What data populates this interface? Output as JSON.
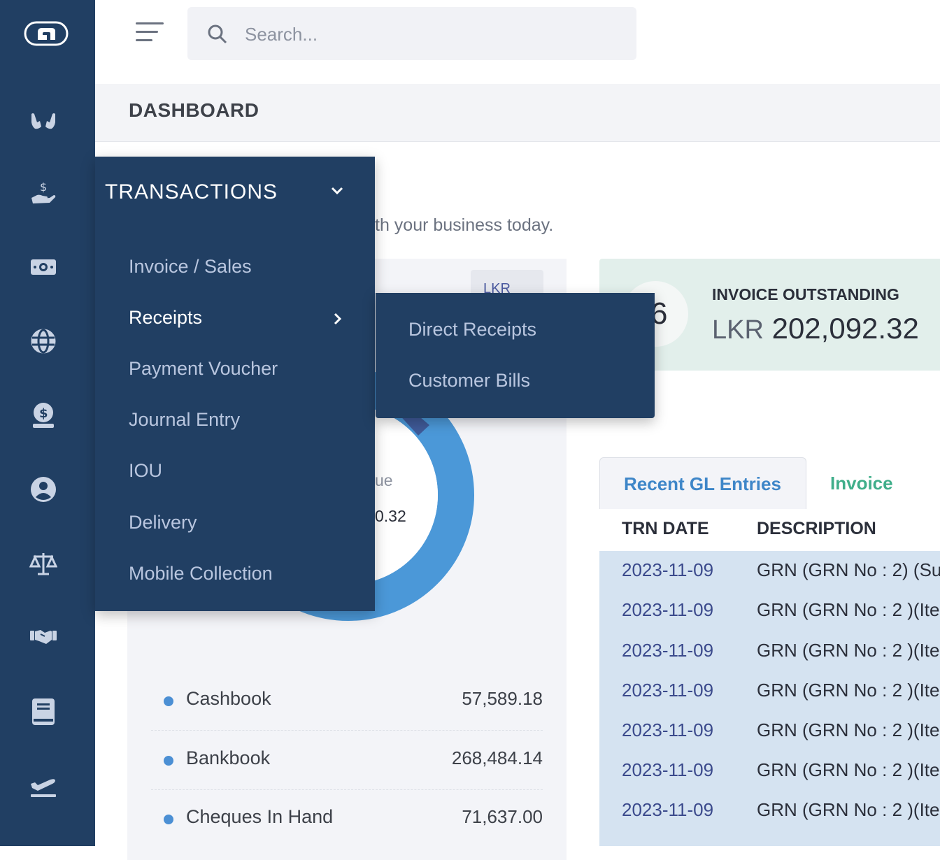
{
  "search": {
    "placeholder": "Search..."
  },
  "page": {
    "title": "DASHBOARD",
    "subtitle": "th your business today."
  },
  "currency_select": {
    "value": "LKR"
  },
  "donut": {
    "label": "ue",
    "value": "0.32",
    "colors": {
      "primary": "#4b98d8",
      "accent": "#3f5a98"
    }
  },
  "balances": [
    {
      "label": "Cashbook",
      "value": "57,589.18"
    },
    {
      "label": "Bankbook",
      "value": "268,484.14"
    },
    {
      "label": "Cheques In Hand",
      "value": "71,637.00"
    }
  ],
  "stat": {
    "count": "6",
    "title": "INVOICE OUTSTANDING",
    "currency": "LKR",
    "amount": "202,092.32"
  },
  "tabs": [
    {
      "label": "Recent GL Entries"
    },
    {
      "label": "Invoice"
    }
  ],
  "table": {
    "columns": [
      "TRN DATE",
      "DESCRIPTION"
    ],
    "rows": [
      {
        "date": "2023-11-09",
        "desc": "GRN (GRN No : 2) (Su"
      },
      {
        "date": "2023-11-09",
        "desc": "GRN (GRN No : 2 )(Ite"
      },
      {
        "date": "2023-11-09",
        "desc": "GRN (GRN No : 2 )(Ite"
      },
      {
        "date": "2023-11-09",
        "desc": "GRN (GRN No : 2 )(Ite"
      },
      {
        "date": "2023-11-09",
        "desc": "GRN (GRN No : 2 )(Ite"
      },
      {
        "date": "2023-11-09",
        "desc": "GRN (GRN No : 2 )(Ite"
      },
      {
        "date": "2023-11-09",
        "desc": "GRN (GRN No : 2 )(Ite"
      }
    ]
  },
  "menu": {
    "title": "TRANSACTIONS",
    "items": [
      {
        "label": "Invoice / Sales"
      },
      {
        "label": "Receipts"
      },
      {
        "label": "Payment Voucher"
      },
      {
        "label": "Journal Entry"
      },
      {
        "label": "IOU"
      },
      {
        "label": "Delivery"
      },
      {
        "label": "Mobile Collection"
      }
    ],
    "submenu": [
      {
        "label": "Direct Receipts"
      },
      {
        "label": "Customer Bills"
      }
    ]
  },
  "sidebar": {
    "icons": [
      "hands-icon",
      "hand-dollar-icon",
      "banknote-icon",
      "globe-icon",
      "money-bag-icon",
      "user-circle-icon",
      "scale-icon",
      "handshake-icon",
      "book-icon",
      "plane-departure-icon"
    ]
  },
  "colors": {
    "sidebar": "#213f63",
    "active_tab": "#3e86c8",
    "inactive_tab": "#3fae8a",
    "stat_card": "#e2efeb",
    "table_body": "#d5e3f1"
  }
}
